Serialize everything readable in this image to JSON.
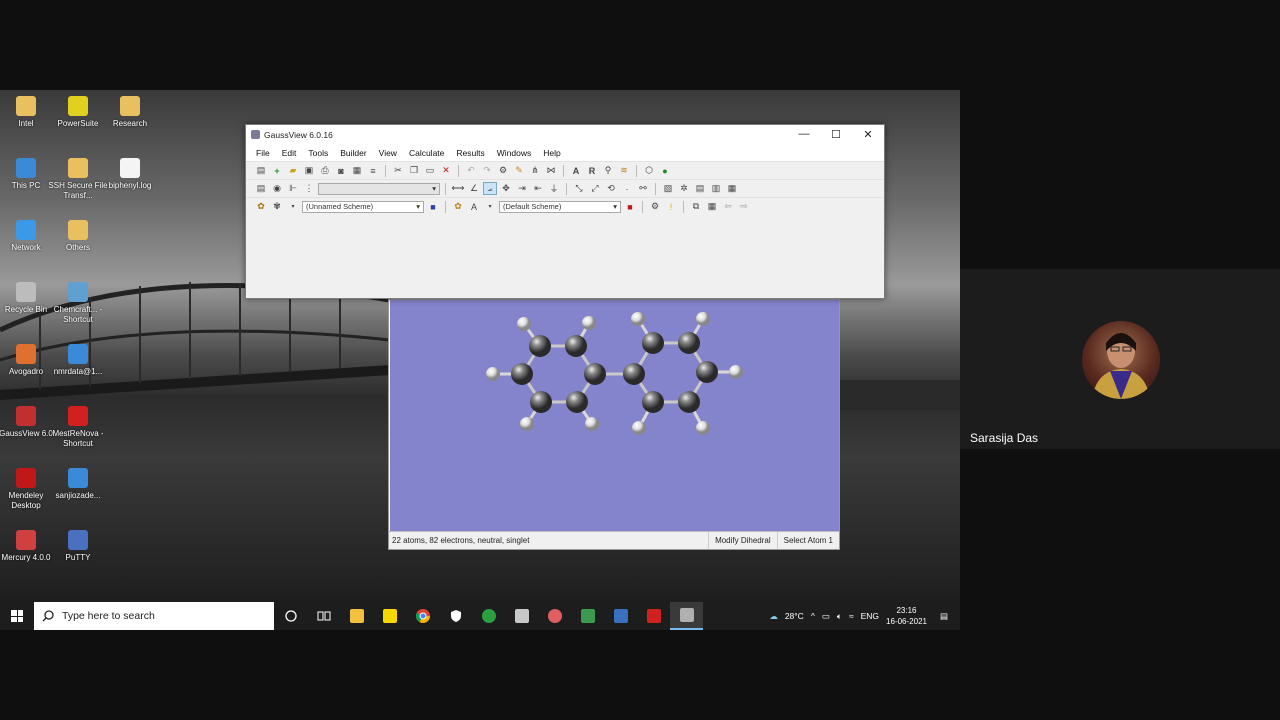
{
  "desktop": {
    "icons": [
      {
        "label": "Intel",
        "color": "#e8c060"
      },
      {
        "label": "PowerSuite",
        "color": "#e0d020"
      },
      {
        "label": "Research",
        "color": "#e8c060"
      },
      {
        "label": "This PC",
        "color": "#3a8ad8"
      },
      {
        "label": "SSH Secure File Transf...",
        "color": "#e8c060"
      },
      {
        "label": "biphenyl.log",
        "color": "#f4f4f4"
      },
      {
        "label": "Network",
        "color": "#3a9ae8"
      },
      {
        "label": "Others",
        "color": "#e8c060"
      },
      {
        "label": "Recycle Bin",
        "color": "#bcbcbc"
      },
      {
        "label": "Chemcraft... - Shortcut",
        "color": "#60a0d0"
      },
      {
        "label": "Avogadro",
        "color": "#e07030"
      },
      {
        "label": "nmrdata@1...",
        "color": "#3a8ad8"
      },
      {
        "label": "GaussView 6.0",
        "color": "#c03030"
      },
      {
        "label": "MestReNova - Shortcut",
        "color": "#d02020"
      },
      {
        "label": "Mendeley Desktop",
        "color": "#c01818"
      },
      {
        "label": "sanjiozade...",
        "color": "#3a8ad8"
      },
      {
        "label": "Mercury 4.0.0",
        "color": "#d04040"
      },
      {
        "label": "PuTTY",
        "color": "#4a70c0"
      }
    ]
  },
  "taskbar": {
    "search_placeholder": "Type here to search",
    "apps": [
      "cortana-icon",
      "task-view-icon",
      "file-explorer-icon",
      "sticky-notes-icon",
      "chrome-icon",
      "security-icon",
      "app-icon",
      "app-icon",
      "app-icon",
      "app-icon",
      "app-icon",
      "acrobat-icon",
      "gaussview-icon"
    ],
    "weather": "28°C",
    "lang": "ENG",
    "time": "23:16",
    "date": "16-06-2021"
  },
  "gaussview": {
    "title": "GaussView 6.0.16",
    "menu": [
      "File",
      "Edit",
      "Tools",
      "Builder",
      "View",
      "Calculate",
      "Results",
      "Windows",
      "Help"
    ],
    "scheme1": "(Unnamed Scheme)",
    "scheme2": "(Default Scheme)"
  },
  "viewer": {
    "status_left": "22 atoms, 82 electrons, neutral, singlet",
    "mode": "Modify Dihedral",
    "hint": "Select Atom 1",
    "background": "#8484cc"
  },
  "participant": {
    "name": "Sarasija Das"
  }
}
